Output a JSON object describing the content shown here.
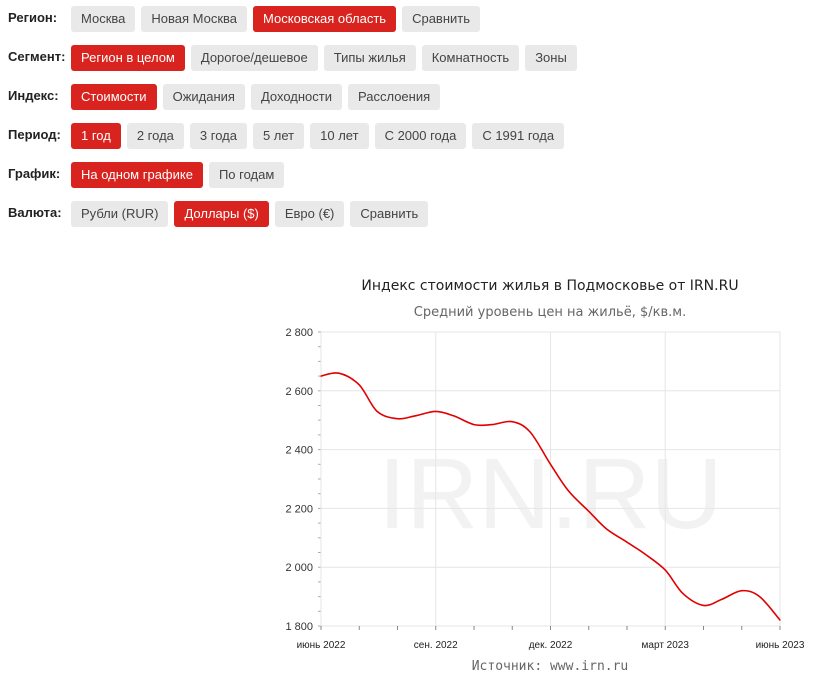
{
  "filters": {
    "region": {
      "label": "Регион:",
      "options": [
        "Москва",
        "Новая Москва",
        "Московская область",
        "Сравнить"
      ],
      "active": 2
    },
    "segment": {
      "label": "Сегмент:",
      "options": [
        "Регион в целом",
        "Дорогое/дешевое",
        "Типы жилья",
        "Комнатность",
        "Зоны"
      ],
      "active": 0
    },
    "index": {
      "label": "Индекс:",
      "options": [
        "Стоимости",
        "Ожидания",
        "Доходности",
        "Расслоения"
      ],
      "active": 0
    },
    "period": {
      "label": "Период:",
      "options": [
        "1 год",
        "2 года",
        "3 года",
        "5 лет",
        "10 лет",
        "С 2000 года",
        "С 1991 года"
      ],
      "active": 0
    },
    "graph": {
      "label": "График:",
      "options": [
        "На одном графике",
        "По годам"
      ],
      "active": 0
    },
    "currency": {
      "label": "Валюта:",
      "options": [
        "Рубли (RUR)",
        "Доллары ($)",
        "Евро (€)",
        "Сравнить"
      ],
      "active": 1
    }
  },
  "colors": {
    "accent": "#d9231e",
    "inactive_button": "#e9e9e9",
    "line": "#e00000",
    "watermark": "#f2f2f2"
  },
  "chart": {
    "title": "Индекс стоимости жилья в Подмосковье от IRN.RU",
    "subtitle": "Средний уровень цен на жильё, $/кв.м.",
    "watermark": "IRN.RU",
    "source": "Источник: www.irn.ru"
  },
  "chart_data": {
    "type": "line",
    "title": "Индекс стоимости жилья в Подмосковье от IRN.RU",
    "subtitle": "Средний уровень цен на жильё, $/кв.м.",
    "xlabel": "",
    "ylabel": "",
    "ylim": [
      1800,
      2800
    ],
    "yticks": [
      1800,
      2000,
      2200,
      2400,
      2600,
      2800
    ],
    "ytick_labels": [
      "1 800",
      "2 000",
      "2 200",
      "2 400",
      "2 600",
      "2 800"
    ],
    "xticks": [
      "июнь 2022",
      "сен. 2022",
      "дек. 2022",
      "март 2023",
      "июнь 2023"
    ],
    "xlim_months": [
      "2022-06",
      "2023-06"
    ],
    "grid": true,
    "series": [
      {
        "x": [
          "2022-06",
          "2022-06-15",
          "2022-07",
          "2022-07-15",
          "2022-08",
          "2022-08-15",
          "2022-09",
          "2022-09-15",
          "2022-10",
          "2022-10-15",
          "2022-11",
          "2022-11-15",
          "2022-12",
          "2022-12-15",
          "2023-01",
          "2023-01-15",
          "2023-02",
          "2023-02-15",
          "2023-03",
          "2023-03-15",
          "2023-04",
          "2023-04-15",
          "2023-05",
          "2023-05-15",
          "2023-06"
        ],
        "values": [
          2650,
          2660,
          2620,
          2530,
          2505,
          2515,
          2530,
          2515,
          2485,
          2485,
          2495,
          2460,
          2350,
          2260,
          2190,
          2130,
          2085,
          2045,
          1990,
          1910,
          1870,
          1890,
          1920,
          1900,
          1820
        ]
      }
    ]
  }
}
